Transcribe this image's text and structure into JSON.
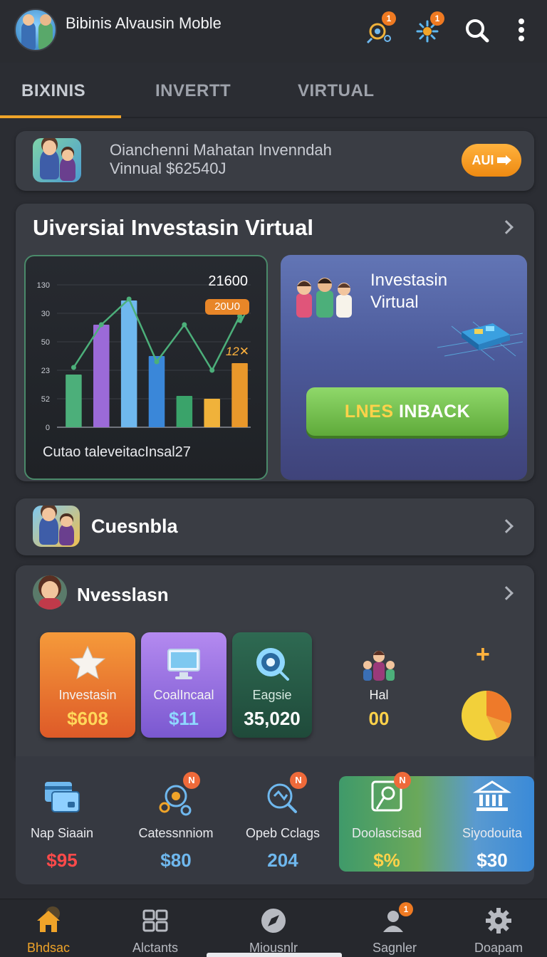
{
  "app": {
    "title": "Bibinis Alvausin Moble",
    "icons": [
      "idea-icon",
      "network-icon",
      "search-icon",
      "more-vert-icon"
    ],
    "badges": [
      "1",
      "1"
    ]
  },
  "tabs": [
    {
      "label": "BIXINIS",
      "active": true
    },
    {
      "label": "INVERTT",
      "active": false
    },
    {
      "label": "VIRTUAL",
      "active": false
    }
  ],
  "promo": {
    "line1": "Oianchenni Mahatan Invenndah",
    "line2": "Vinnual $62540J",
    "button_label": "AUI"
  },
  "virtual_section": {
    "title": "Uiversiai Investasin Virtual",
    "chart_panel": {
      "number": "21600",
      "pill": "20U0",
      "tag": "12",
      "caption": "Cutao taleveitacInsal27"
    },
    "invest_panel": {
      "title": "Investasin Virtual",
      "cta_highlight": "LNES",
      "cta_rest": "INBACK"
    }
  },
  "chart_data": {
    "type": "bar",
    "y_tick_labels": [
      "0",
      "52",
      "23",
      "50",
      "30",
      "130"
    ],
    "values": [
      37,
      72,
      89,
      50,
      22,
      20,
      45
    ],
    "ylim": [
      0,
      100
    ],
    "trend": [
      42,
      72,
      90,
      46,
      72,
      40,
      78
    ],
    "colors": [
      "#4caf7a",
      "#9b6ad8",
      "#6fb8ee",
      "#3a87d9",
      "#3aa36a",
      "#f0b23a",
      "#e9982b"
    ],
    "grid": true
  },
  "cuesnbla": {
    "title": "Cuesnbla"
  },
  "nvesslasn": {
    "title": "Nvesslasn",
    "tiles": [
      {
        "label": "Investasin",
        "value": "$608",
        "color": "#ffd75a"
      },
      {
        "label": "CoalIncaal",
        "value": "$11",
        "color": "#8fd8ff"
      },
      {
        "label": "Eagsie",
        "value": "35,020",
        "color": "#ffffff"
      },
      {
        "label": "Hal",
        "value": "00",
        "color": "#ffd24a"
      }
    ],
    "plus_label": "+"
  },
  "stats": [
    {
      "label": "Nap Siaain",
      "value": "$95",
      "color": "#ff4a4a",
      "icon": "card-icon"
    },
    {
      "label": "Catessnniom",
      "value": "$80",
      "color": "#6fb8ee",
      "icon": "coins-icon",
      "badge": "N"
    },
    {
      "label": "Opeb Cclags",
      "value": "204",
      "color": "#6fb8ee",
      "icon": "target-icon",
      "badge": "N"
    },
    {
      "label": "Doolascisad",
      "value": "$%",
      "color": "#ffd24a",
      "icon": "map-icon",
      "badge": "N"
    },
    {
      "label": "Siyodouita",
      "value": "$30",
      "color": "#ffffff",
      "icon": "bank-icon"
    }
  ],
  "bottom_nav": [
    {
      "label": "Bhdsac",
      "icon": "home-icon",
      "active": true
    },
    {
      "label": "Alctants",
      "icon": "grid-icon",
      "active": false
    },
    {
      "label": "Miousnlr",
      "icon": "compass-icon",
      "active": false
    },
    {
      "label": "Sagnler",
      "icon": "user-icon",
      "active": false,
      "badge": "1"
    },
    {
      "label": "Doapam",
      "icon": "gear-icon",
      "active": false
    }
  ]
}
